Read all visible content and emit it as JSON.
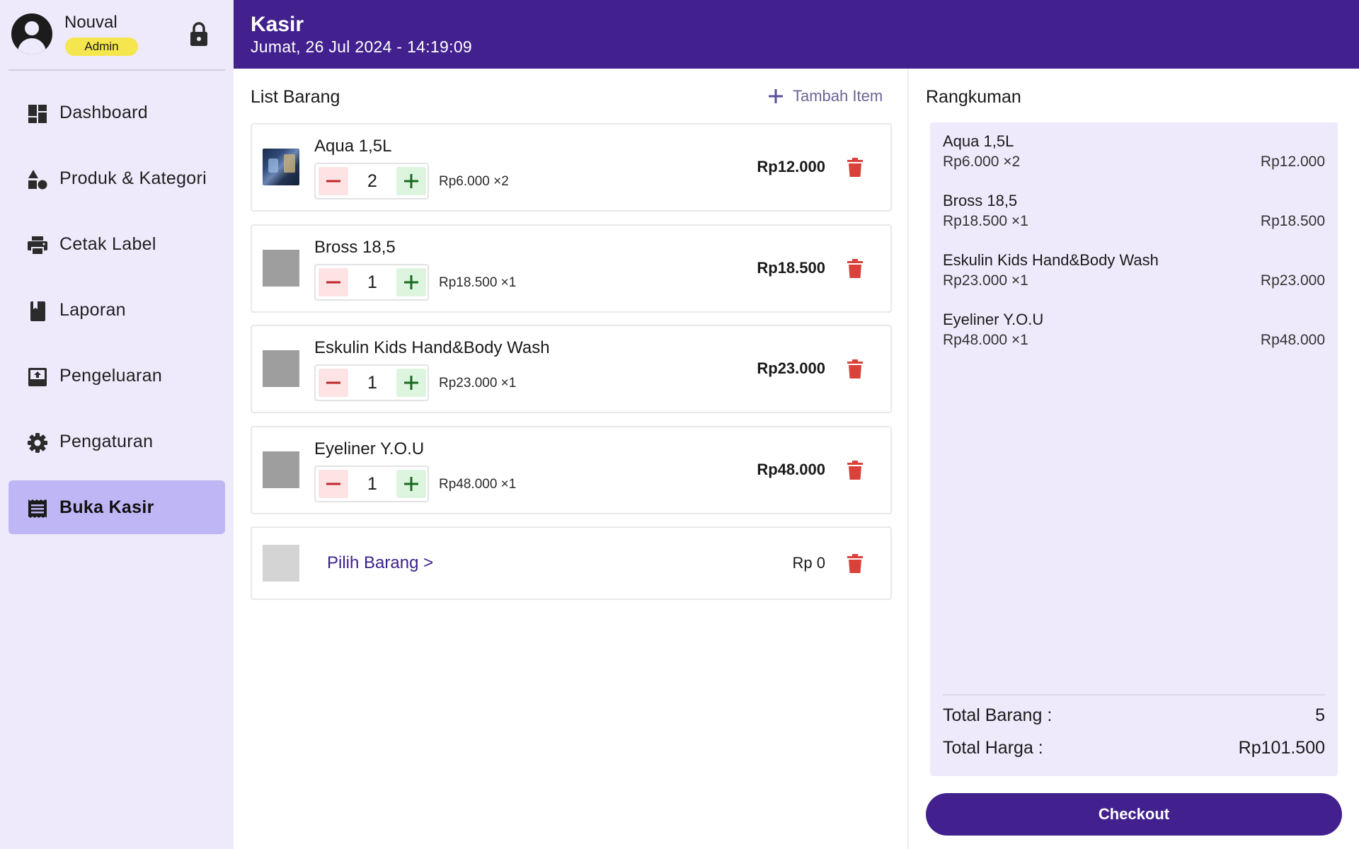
{
  "profile": {
    "name": "Nouval",
    "role": "Admin"
  },
  "sidebar": {
    "items": [
      {
        "label": "Dashboard",
        "icon": "dashboard-icon",
        "active": false
      },
      {
        "label": "Produk & Kategori",
        "icon": "category-icon",
        "active": false
      },
      {
        "label": "Cetak Label",
        "icon": "printer-icon",
        "active": false
      },
      {
        "label": "Laporan",
        "icon": "book-icon",
        "active": false
      },
      {
        "label": "Pengeluaran",
        "icon": "outbox-icon",
        "active": false
      },
      {
        "label": "Pengaturan",
        "icon": "gear-icon",
        "active": false
      },
      {
        "label": "Buka Kasir",
        "icon": "receipt-icon",
        "active": true
      }
    ]
  },
  "header": {
    "title": "Kasir",
    "datetime": "Jumat, 26 Jul 2024 - 14:19:09"
  },
  "list": {
    "title": "List Barang",
    "add_label": "Tambah Item",
    "items": [
      {
        "name": "Aqua 1,5L",
        "qty": "2",
        "unit": "Rp6.000 ×2",
        "total": "Rp12.000"
      },
      {
        "name": "Bross 18,5",
        "qty": "1",
        "unit": "Rp18.500 ×1",
        "total": "Rp18.500"
      },
      {
        "name": "Eskulin Kids Hand&Body Wash",
        "qty": "1",
        "unit": "Rp23.000 ×1",
        "total": "Rp23.000"
      },
      {
        "name": "Eyeliner Y.O.U",
        "qty": "1",
        "unit": "Rp48.000 ×1",
        "total": "Rp48.000"
      }
    ],
    "empty_row": {
      "pick_label": "Pilih Barang >",
      "total": "Rp 0"
    }
  },
  "summary": {
    "title": "Rangkuman",
    "items": [
      {
        "name": "Aqua 1,5L",
        "detail": "Rp6.000 ×2",
        "total": "Rp12.000"
      },
      {
        "name": "Bross 18,5",
        "detail": "Rp18.500 ×1",
        "total": "Rp18.500"
      },
      {
        "name": "Eskulin Kids Hand&Body Wash",
        "detail": "Rp23.000 ×1",
        "total": "Rp23.000"
      },
      {
        "name": "Eyeliner Y.O.U",
        "detail": "Rp48.000 ×1",
        "total": "Rp48.000"
      }
    ],
    "total_items_label": "Total Barang :",
    "total_items_value": "5",
    "total_price_label": "Total Harga :",
    "total_price_value": "Rp101.500",
    "checkout_label": "Checkout"
  },
  "colors": {
    "header": "#42218e",
    "sidebar_bg": "#efeafb",
    "sidebar_active": "#bfb6f5",
    "role_badge": "#f5e64d",
    "delete": "#d9413a",
    "minus_bg": "#fde3e3",
    "plus_bg": "#ddf5de"
  }
}
